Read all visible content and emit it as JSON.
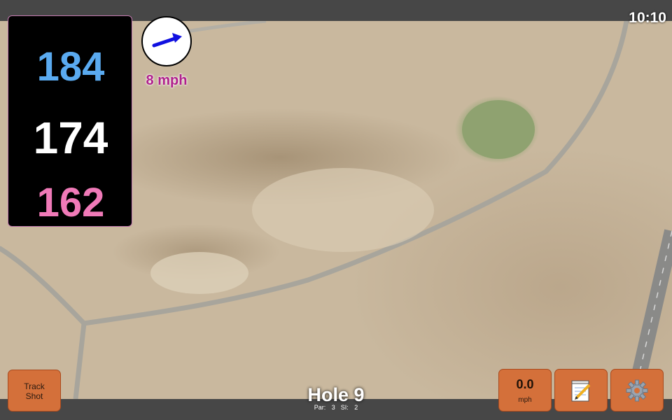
{
  "status": {
    "time": "10:10"
  },
  "distances": {
    "back": "184",
    "middle": "174",
    "front": "162"
  },
  "wind": {
    "speed_text": "8 mph",
    "direction_icon": "wind-arrow-icon",
    "arrow_color": "#1010e0"
  },
  "buttons": {
    "track_shot_line1": "Track",
    "track_shot_line2": "Shot",
    "speed_value": "0.0",
    "speed_unit": "mph",
    "notes_icon": "notepad-icon",
    "settings_icon": "gear-icon"
  },
  "hole": {
    "title": "Hole 9",
    "par": "Par: 3",
    "si": "SI: 2"
  },
  "colors": {
    "back": "#5aaaf0",
    "middle": "#ffffff",
    "front": "#f07ab8",
    "button": "#d4703a",
    "bar": "#474747"
  }
}
